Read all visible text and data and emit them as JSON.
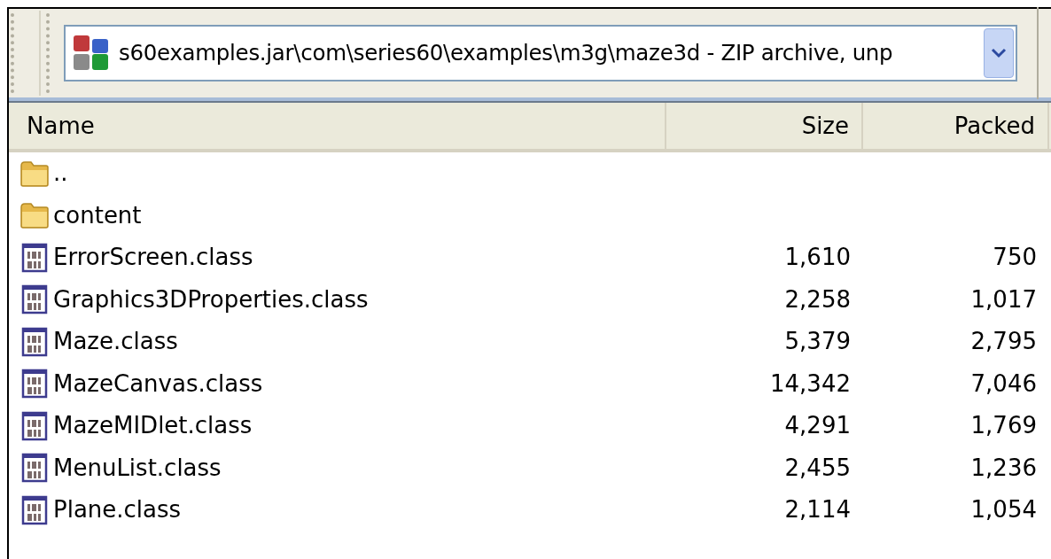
{
  "address_bar": {
    "value": "s60examples.jar\\com\\series60\\examples\\m3g\\maze3d - ZIP archive, unp"
  },
  "table": {
    "columns": [
      "Name",
      "Size",
      "Packed"
    ],
    "rows": [
      {
        "kind": "folder",
        "name": "..",
        "size": "",
        "packed": ""
      },
      {
        "kind": "folder",
        "name": "content",
        "size": "",
        "packed": ""
      },
      {
        "kind": "file",
        "name": "ErrorScreen.class",
        "size": "1,610",
        "packed": "750"
      },
      {
        "kind": "file",
        "name": "Graphics3DProperties.class",
        "size": "2,258",
        "packed": "1,017"
      },
      {
        "kind": "file",
        "name": "Maze.class",
        "size": "5,379",
        "packed": "2,795"
      },
      {
        "kind": "file",
        "name": "MazeCanvas.class",
        "size": "14,342",
        "packed": "7,046"
      },
      {
        "kind": "file",
        "name": "MazeMIDlet.class",
        "size": "4,291",
        "packed": "1,769"
      },
      {
        "kind": "file",
        "name": "MenuList.class",
        "size": "2,455",
        "packed": "1,236"
      },
      {
        "kind": "file",
        "name": "Plane.class",
        "size": "2,114",
        "packed": "1,054"
      }
    ]
  }
}
